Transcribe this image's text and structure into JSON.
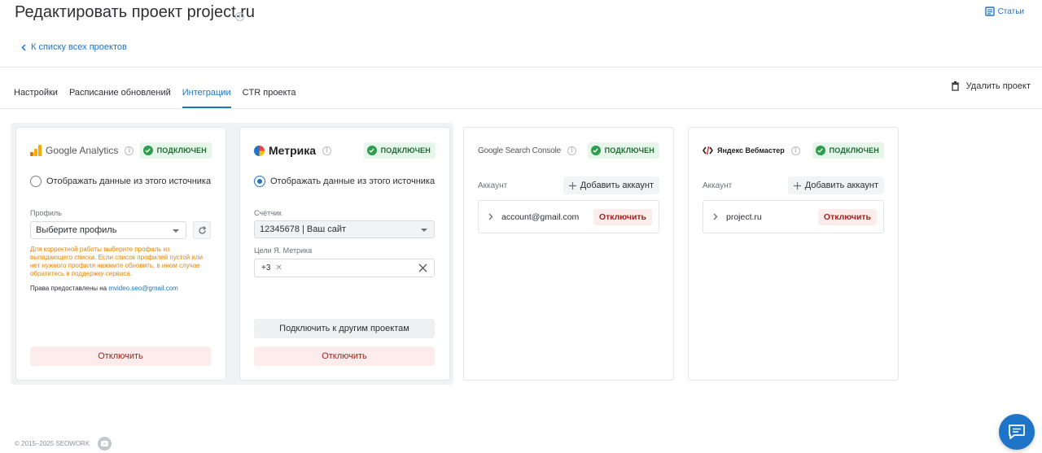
{
  "header": {
    "title": "Редактировать проект project.ru",
    "articles_label": "Статьи",
    "back_link": "К списку всех проектов"
  },
  "tabs": [
    {
      "label": "Настройки",
      "active": false
    },
    {
      "label": "Расписание обновлений",
      "active": false
    },
    {
      "label": "Интеграции",
      "active": true
    },
    {
      "label": "CTR проекта",
      "active": false
    }
  ],
  "delete_project_label": "Удалить проект",
  "colors": {
    "accent": "#1e74c7",
    "success": "#2e9d4c",
    "danger": "#a3231d",
    "warning": "#e8830c"
  },
  "cards": {
    "ga": {
      "name": "Google Analytics",
      "status": "ПОДКЛЮЧЕН",
      "radio_label": "Отображать данные из этого источника",
      "radio_checked": false,
      "profile_label": "Профиль",
      "profile_value": "Выберите профиль",
      "hint": "Для корректной работы выберите профиль из выпадающего списка. Если список профилей пустой или нет нужного профиля нажмите обновить, в ином случае обратитесь в поддержку сервиса.",
      "rights_prefix": "Права предоставлены на",
      "rights_email": "mvideo.seo@gmail.com",
      "disconnect": "Отключить"
    },
    "metrika": {
      "name": "Метрика",
      "status": "ПОДКЛЮЧЕН",
      "radio_label": "Отображать данные из этого источника",
      "radio_checked": true,
      "counter_label": "Счётчик",
      "counter_value": "12345678 | Ваш сайт",
      "goals_label": "Цели Я. Метрика",
      "goals_value": "+3",
      "connect_other": "Подключить к другим проектам",
      "disconnect": "Отключить"
    },
    "gsc": {
      "name": "Google Search Console",
      "status": "ПОДКЛЮЧЕН",
      "account_label": "Аккаунт",
      "add_account": "Добавить аккаунт",
      "account": "account@gmail.com",
      "disconnect": "Отключить"
    },
    "webmaster": {
      "name": "Яндекс Вебмастер",
      "status": "ПОДКЛЮЧЕН",
      "account_label": "Аккаунт",
      "add_account": "Добавить аккаунт",
      "account": "project.ru",
      "disconnect": "Отключить"
    }
  },
  "footer": {
    "copyright": "© 2015–2025 SEOWORK"
  },
  "icons": [
    "info-icon",
    "articles-icon",
    "chevron-left-icon",
    "trash-icon",
    "check-icon",
    "refresh-icon",
    "plus-icon",
    "chevron-right-icon",
    "close-icon",
    "youtube-icon",
    "chat-icon"
  ]
}
